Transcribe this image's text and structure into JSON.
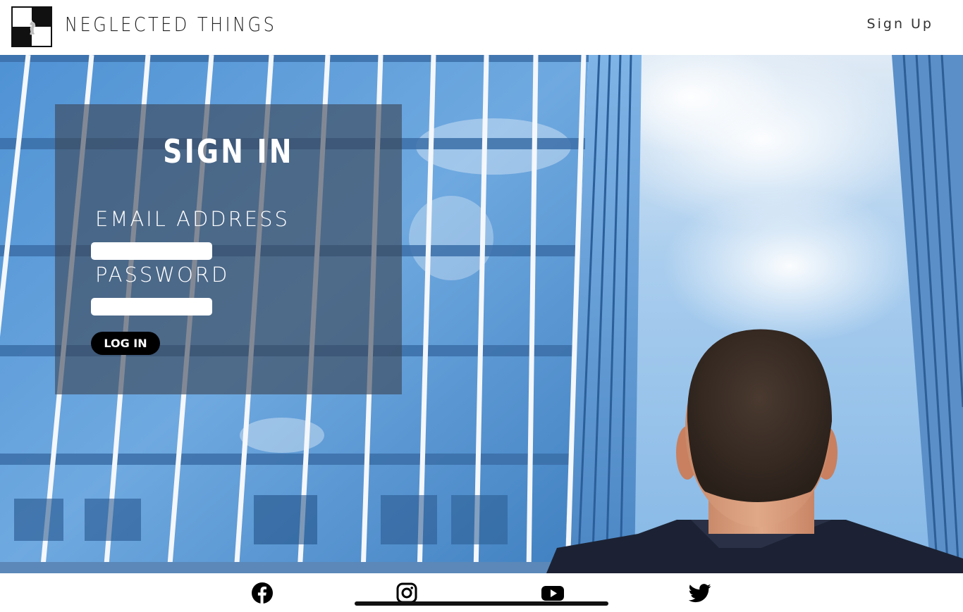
{
  "header": {
    "brand": "NEGLECTED THINGS",
    "logo_icon": "chess-knight-logo-icon",
    "signup_link": "Sign Up"
  },
  "signin": {
    "title": "SIGN IN",
    "email_label": "EMAIL ADDRESS",
    "email_value": "",
    "password_label": "PASSWORD",
    "password_value": "",
    "login_button": "LOG IN"
  },
  "hero": {
    "image_icon": "office-building-and-businessman-photo"
  },
  "footer": {
    "social": [
      {
        "icon": "facebook-icon"
      },
      {
        "icon": "instagram-icon"
      },
      {
        "icon": "youtube-icon"
      },
      {
        "icon": "twitter-icon"
      }
    ]
  },
  "colors": {
    "panel_bg": "#3c4655",
    "button_bg": "#000000",
    "header_bg": "#ffffff"
  }
}
